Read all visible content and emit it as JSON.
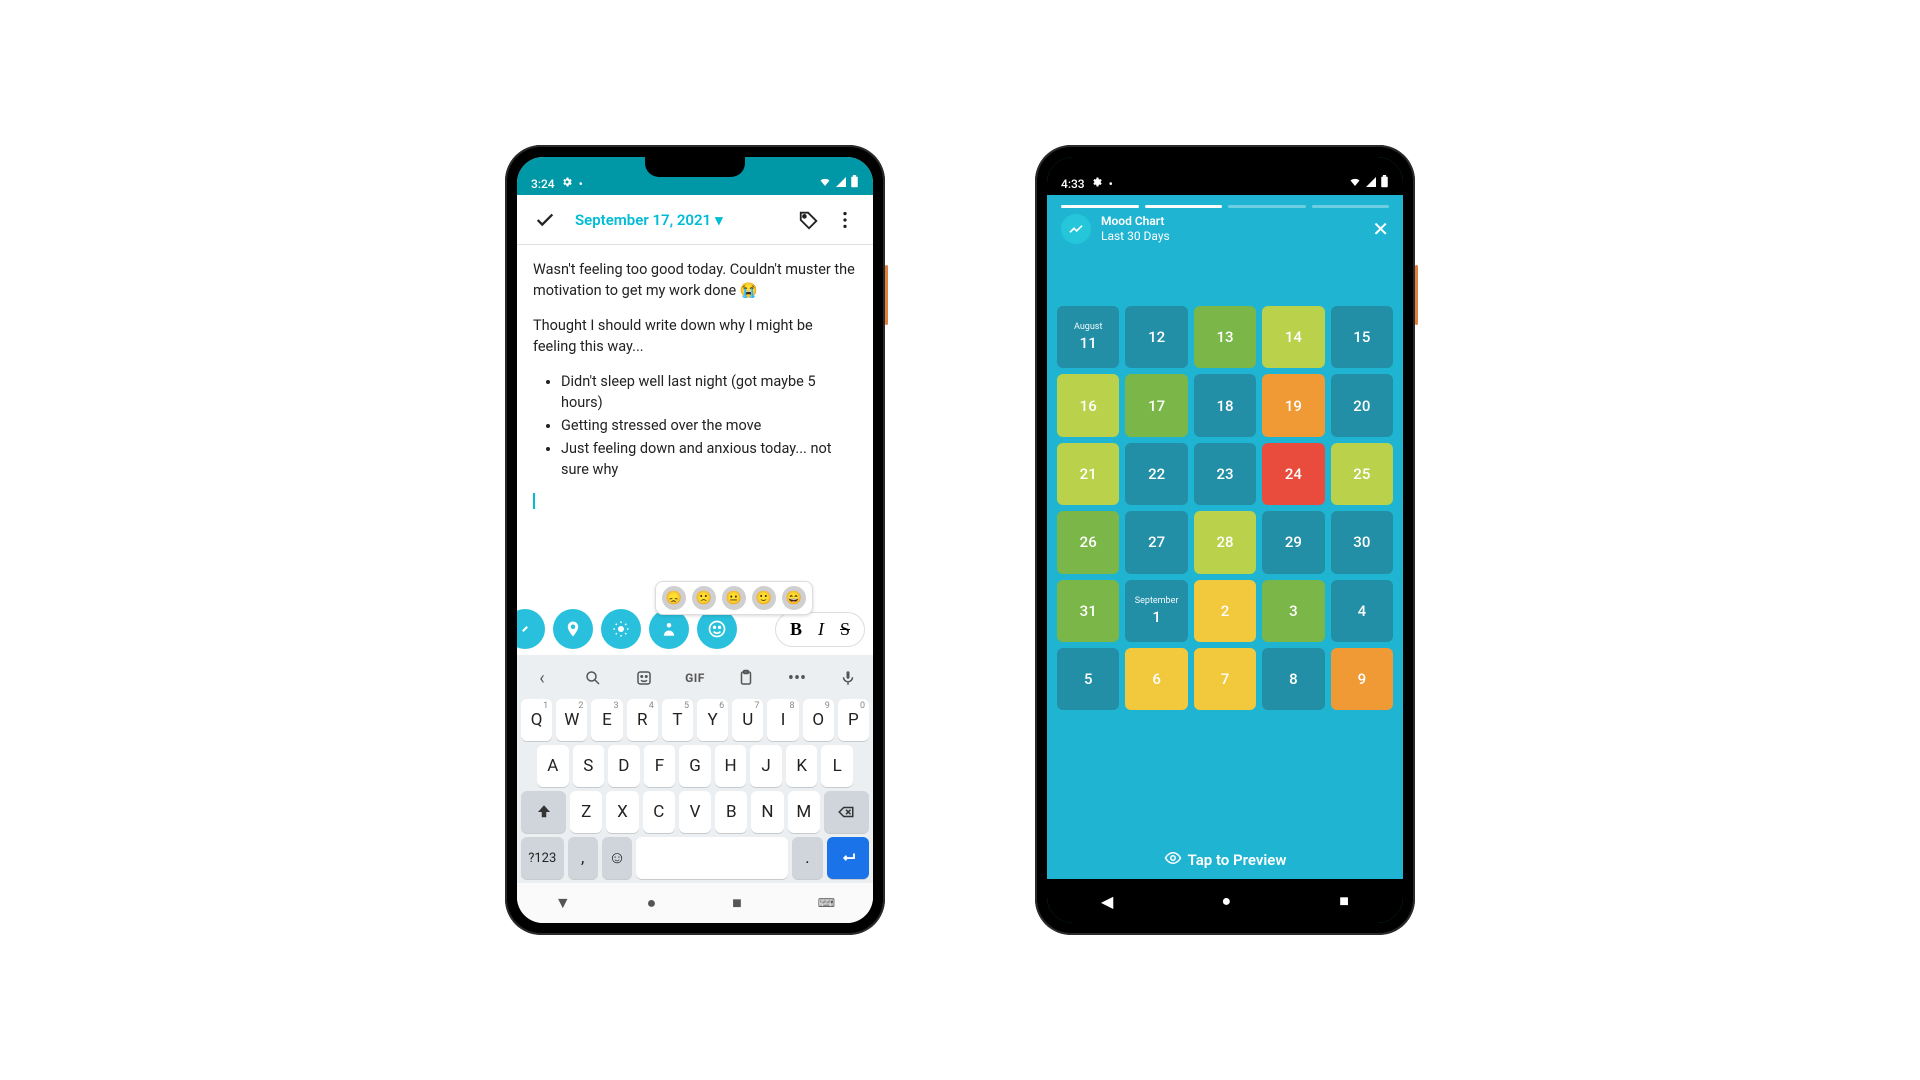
{
  "phone1": {
    "status": {
      "time": "3:24"
    },
    "appbar": {
      "date": "September 17, 2021"
    },
    "note": {
      "p1": "Wasn't feeling too good today. Couldn't muster the motivation to get my work done 😭",
      "p2": "Thought I should write down why I might be feeling this way...",
      "bullets": [
        "Didn't sleep well last night (got maybe 5 hours)",
        "Getting stressed over the move",
        "Just feeling down and anxious today... not sure why"
      ]
    },
    "format": {
      "bold": "B",
      "italic": "I",
      "strike": "S"
    },
    "kb": {
      "gif": "GIF",
      "row1": [
        "Q",
        "W",
        "E",
        "R",
        "T",
        "Y",
        "U",
        "I",
        "O",
        "P"
      ],
      "row1_sup": [
        "1",
        "2",
        "3",
        "4",
        "5",
        "6",
        "7",
        "8",
        "9",
        "0"
      ],
      "row2": [
        "A",
        "S",
        "D",
        "F",
        "G",
        "H",
        "J",
        "K",
        "L"
      ],
      "row3": [
        "Z",
        "X",
        "C",
        "V",
        "B",
        "N",
        "M"
      ],
      "sym": "?123",
      "comma": ",",
      "period": "."
    }
  },
  "phone2": {
    "status": {
      "time": "4:33"
    },
    "header": {
      "title": "Mood Chart",
      "subtitle": "Last 30 Days"
    },
    "tap": "Tap to Preview",
    "months": {
      "aug": "August",
      "sep": "September"
    }
  },
  "chart_data": {
    "type": "heatmap",
    "title": "Mood Chart — Last 30 Days",
    "mood_scale_note": "Colors map to mood: teal=neutral/low, green/lime=good, yellow/orange=bad, red=worst",
    "days": [
      {
        "month": "August",
        "day": 11,
        "mood": "teal"
      },
      {
        "month": "August",
        "day": 12,
        "mood": "teal"
      },
      {
        "month": "August",
        "day": 13,
        "mood": "green"
      },
      {
        "month": "August",
        "day": 14,
        "mood": "lime"
      },
      {
        "month": "August",
        "day": 15,
        "mood": "teal"
      },
      {
        "month": "August",
        "day": 16,
        "mood": "lime"
      },
      {
        "month": "August",
        "day": 17,
        "mood": "green"
      },
      {
        "month": "August",
        "day": 18,
        "mood": "teal"
      },
      {
        "month": "August",
        "day": 19,
        "mood": "orange"
      },
      {
        "month": "August",
        "day": 20,
        "mood": "teal"
      },
      {
        "month": "August",
        "day": 21,
        "mood": "lime"
      },
      {
        "month": "August",
        "day": 22,
        "mood": "teal"
      },
      {
        "month": "August",
        "day": 23,
        "mood": "teal"
      },
      {
        "month": "August",
        "day": 24,
        "mood": "red"
      },
      {
        "month": "August",
        "day": 25,
        "mood": "lime"
      },
      {
        "month": "August",
        "day": 26,
        "mood": "green"
      },
      {
        "month": "August",
        "day": 27,
        "mood": "teal"
      },
      {
        "month": "August",
        "day": 28,
        "mood": "lime"
      },
      {
        "month": "August",
        "day": 29,
        "mood": "teal"
      },
      {
        "month": "August",
        "day": 30,
        "mood": "teal"
      },
      {
        "month": "August",
        "day": 31,
        "mood": "green"
      },
      {
        "month": "September",
        "day": 1,
        "mood": "teal"
      },
      {
        "month": "September",
        "day": 2,
        "mood": "yellow"
      },
      {
        "month": "September",
        "day": 3,
        "mood": "green"
      },
      {
        "month": "September",
        "day": 4,
        "mood": "teal"
      },
      {
        "month": "September",
        "day": 5,
        "mood": "teal"
      },
      {
        "month": "September",
        "day": 6,
        "mood": "yellow"
      },
      {
        "month": "September",
        "day": 7,
        "mood": "yellow"
      },
      {
        "month": "September",
        "day": 8,
        "mood": "teal"
      },
      {
        "month": "September",
        "day": 9,
        "mood": "orange"
      }
    ]
  }
}
